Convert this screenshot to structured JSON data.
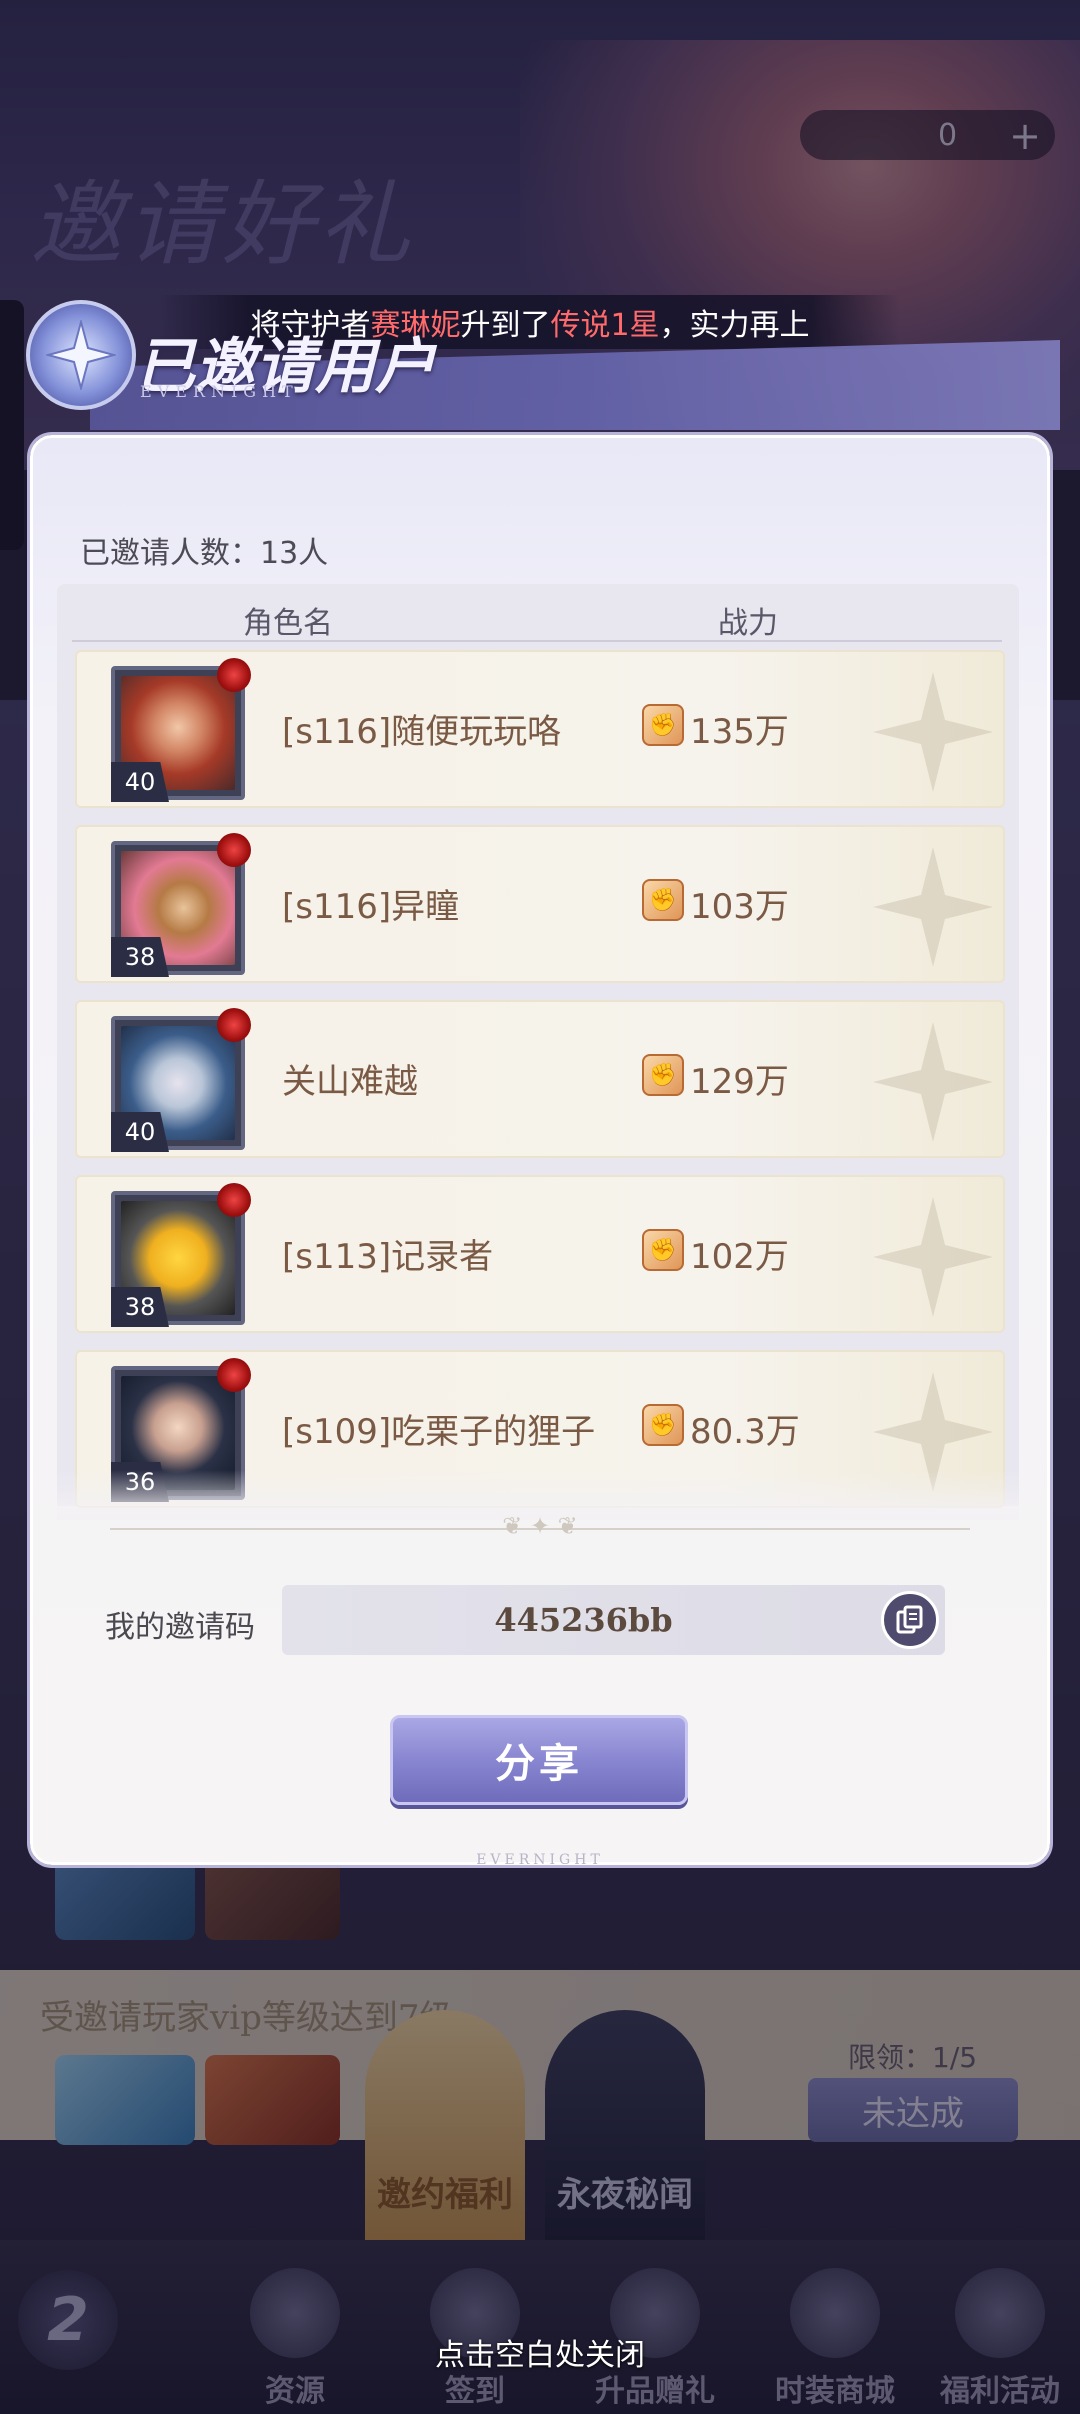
{
  "background": {
    "banner_title": "邀请好礼",
    "currency_value": "0",
    "currency_plus": "+",
    "vip_task": "受邀请玩家vip等级达到7级",
    "task_progress": "限领：1/5",
    "task_status": "未达成",
    "tab_invite": "邀约福利",
    "tab_secret": "永夜秘闻",
    "nav": [
      "资源",
      "签到",
      "升品赠礼",
      "时装商城",
      "福利活动"
    ]
  },
  "marquee": {
    "prefix": "将守护者",
    "hero": "赛琳妮",
    "middle": "升到了",
    "rank": "传说1星",
    "suffix": "，实力再上"
  },
  "panel": {
    "title": "已邀请用户",
    "subtitle": "EVERNIGHT",
    "invite_count": "已邀请人数：13人",
    "col_name": "角色名",
    "col_power": "战力",
    "rows": [
      {
        "level": "40",
        "name": "[s116]随便玩玩咯",
        "power": "135万"
      },
      {
        "level": "38",
        "name": "[s116]异瞳",
        "power": "103万"
      },
      {
        "level": "40",
        "name": "关山难越",
        "power": "129万"
      },
      {
        "level": "38",
        "name": "[s113]记录者",
        "power": "102万"
      },
      {
        "level": "36",
        "name": "[s109]吃栗子的狸子",
        "power": "80.3万"
      }
    ],
    "code_label": "我的邀请码",
    "code_value": "445236bb",
    "share_label": "分享",
    "footer": "EVERNIGHT"
  },
  "close_hint": "点击空白处关闭",
  "colors": {
    "accent": "#8683cf",
    "highlight_red": "#ff6b6b",
    "name_brown": "#7b5a45"
  }
}
